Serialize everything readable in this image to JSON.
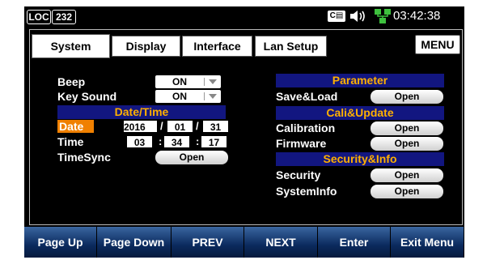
{
  "status": {
    "loc": "LOC",
    "number": "232",
    "card_icon_text": "C⊑",
    "speaker_icon": "speaker-icon",
    "network_icon": "network-icon",
    "time": "03:42:38"
  },
  "tabs": [
    {
      "label": "System",
      "active": true
    },
    {
      "label": "Display",
      "active": false
    },
    {
      "label": "Interface",
      "active": false
    },
    {
      "label": "Lan Setup",
      "active": false
    }
  ],
  "menu_label": "MENU",
  "left": {
    "beep": {
      "label": "Beep",
      "value": "ON"
    },
    "key_sound": {
      "label": "Key Sound",
      "value": "ON"
    },
    "datetime_header": "Date/Time",
    "date": {
      "label": "Date",
      "year": "2016",
      "month": "01",
      "day": "31",
      "separator": "/"
    },
    "time": {
      "label": "Time",
      "hour": "03",
      "minute": "34",
      "second": "17",
      "separator": ":"
    },
    "timesync": {
      "label": "TimeSync",
      "button": "Open"
    }
  },
  "right": {
    "parameter_header": "Parameter",
    "save_load": {
      "label": "Save&Load",
      "button": "Open"
    },
    "cali_header": "Cali&Update",
    "calibration": {
      "label": "Calibration",
      "button": "Open"
    },
    "firmware": {
      "label": "Firmware",
      "button": "Open"
    },
    "security_header": "Security&Info",
    "security": {
      "label": "Security",
      "button": "Open"
    },
    "systeminfo": {
      "label": "SystemInfo",
      "button": "Open"
    }
  },
  "softkeys": [
    "Page Up",
    "Page Down",
    "PREV",
    "NEXT",
    "Enter",
    "Exit Menu"
  ],
  "colors": {
    "header_bg": "#121680",
    "header_text": "#ffb000",
    "highlight": "#f08000"
  }
}
